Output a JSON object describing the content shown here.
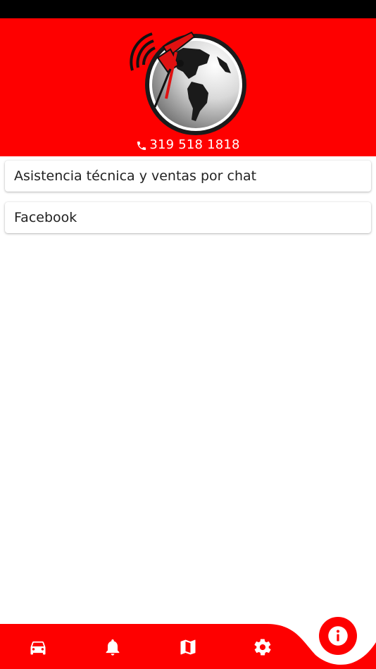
{
  "header": {
    "phone": "319 518 1818",
    "brand_color": "#fe0000"
  },
  "menu": {
    "items": [
      {
        "label": "Asistencia técnica y ventas por chat"
      },
      {
        "label": "Facebook"
      }
    ]
  },
  "bottom_nav": {
    "icons": [
      "car-icon",
      "bell-icon",
      "map-icon",
      "gear-icon"
    ],
    "fab_icon": "info-icon"
  }
}
